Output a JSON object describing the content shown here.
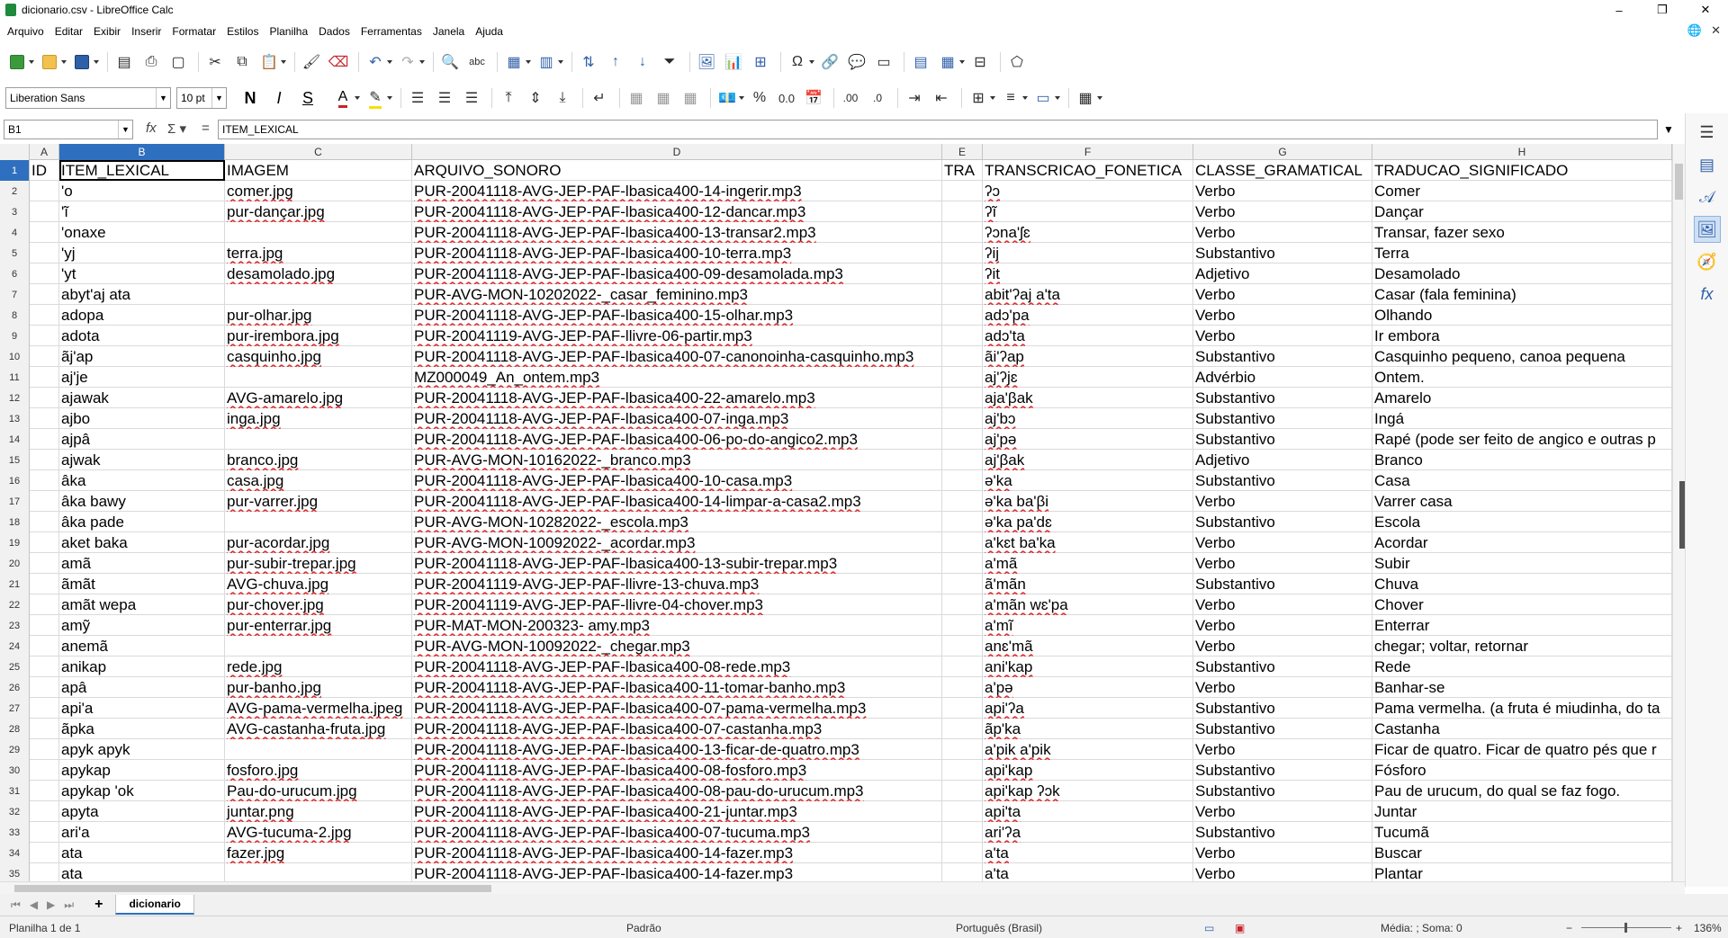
{
  "window": {
    "title": "dicionario.csv - LibreOffice Calc",
    "minimize_label": "–",
    "restore_label": "❐",
    "close_label": "✕"
  },
  "menu": [
    "Arquivo",
    "Editar",
    "Exibir",
    "Inserir",
    "Formatar",
    "Estilos",
    "Planilha",
    "Dados",
    "Ferramentas",
    "Janela",
    "Ajuda"
  ],
  "formatting": {
    "font_name": "Liberation Sans",
    "font_size": "10 pt",
    "bold": "N",
    "italic": "I",
    "shadow": "S"
  },
  "formula_bar": {
    "name_box": "B1",
    "content": "ITEM_LEXICAL"
  },
  "columns": [
    {
      "label": "A",
      "header": "ID"
    },
    {
      "label": "B",
      "header": "ITEM_LEXICAL"
    },
    {
      "label": "C",
      "header": "IMAGEM"
    },
    {
      "label": "D",
      "header": "ARQUIVO_SONORO"
    },
    {
      "label": "E",
      "header": "TRA"
    },
    {
      "label": "F",
      "header": "TRANSCRICAO_FONETICA"
    },
    {
      "label": "G",
      "header": "CLASSE_GRAMATICAL"
    },
    {
      "label": "H",
      "header": "TRADUCAO_SIGNIFICADO"
    }
  ],
  "rows": [
    [
      "",
      "'o",
      "comer.jpg",
      "PUR-20041118-AVG-JEP-PAF-lbasica400-14-ingerir.mp3",
      "",
      "ʔɔ",
      "Verbo",
      "Comer"
    ],
    [
      "",
      "'ĩ",
      "pur-dançar.jpg",
      "PUR-20041118-AVG-JEP-PAF-lbasica400-12-dancar.mp3",
      "",
      "ʔĩ",
      "Verbo",
      "Dançar"
    ],
    [
      "",
      "'onaxe",
      "",
      "PUR-20041118-AVG-JEP-PAF-lbasica400-13-transar2.mp3",
      "",
      "ʔɔna'ʃɛ",
      "Verbo",
      "Transar, fazer sexo"
    ],
    [
      "",
      "'yj",
      "terra.jpg",
      "PUR-20041118-AVG-JEP-PAF-lbasica400-10-terra.mp3",
      "",
      "ʔij",
      "Substantivo",
      "Terra"
    ],
    [
      "",
      "'yt",
      "desamolado.jpg",
      "PUR-20041118-AVG-JEP-PAF-lbasica400-09-desamolada.mp3",
      "",
      "ʔit",
      "Adjetivo",
      "Desamolado"
    ],
    [
      "",
      "abyt'aj ata",
      "",
      "PUR-AVG-MON-10202022-_casar_feminino.mp3",
      "",
      "abit'ʔaj a'ta",
      "Verbo",
      "Casar (fala feminina)"
    ],
    [
      "",
      "adopa",
      "pur-olhar.jpg",
      "PUR-20041118-AVG-JEP-PAF-lbasica400-15-olhar.mp3",
      "",
      "adɔ'pa",
      "Verbo",
      "Olhando"
    ],
    [
      "",
      "adota",
      "pur-irembora.jpg",
      "PUR-20041119-AVG-JEP-PAF-llivre-06-partir.mp3",
      "",
      "adɔ'ta",
      "Verbo",
      "Ir embora"
    ],
    [
      "",
      "ãj'ap",
      "casquinho.jpg",
      "PUR-20041118-AVG-JEP-PAF-lbasica400-07-canonoinha-casquinho.mp3",
      "",
      "ãi'ʔap",
      "Substantivo",
      "Casquinho pequeno, canoa pequena"
    ],
    [
      "",
      "aj'je",
      "",
      "MZ000049_An_ontem.mp3",
      "",
      "aj'ʔjɛ",
      "Advérbio",
      "Ontem."
    ],
    [
      "",
      "ajawak",
      "AVG-amarelo.jpg",
      "PUR-20041118-AVG-JEP-PAF-lbasica400-22-amarelo.mp3",
      "",
      "aja'βak",
      "Substantivo",
      "Amarelo"
    ],
    [
      "",
      "ajbo",
      "inga.jpg",
      "PUR-20041118-AVG-JEP-PAF-lbasica400-07-inga.mp3",
      "",
      "aj'bɔ",
      "Substantivo",
      "Ingá"
    ],
    [
      "",
      "ajpâ",
      "",
      "PUR-20041118-AVG-JEP-PAF-lbasica400-06-po-do-angico2.mp3",
      "",
      "aj'pə",
      "Substantivo",
      "Rapé (pode ser feito de angico e outras p"
    ],
    [
      "",
      "ajwak",
      "branco.jpg",
      "PUR-AVG-MON-10162022-_branco.mp3",
      "",
      "aj'βak",
      "Adjetivo",
      "Branco"
    ],
    [
      "",
      "âka",
      "casa.jpg",
      "PUR-20041118-AVG-JEP-PAF-lbasica400-10-casa.mp3",
      "",
      "ə'ka",
      "Substantivo",
      "Casa"
    ],
    [
      "",
      "âka bawy",
      "pur-varrer.jpg",
      "PUR-20041118-AVG-JEP-PAF-lbasica400-14-limpar-a-casa2.mp3",
      "",
      "ə'ka ba'βi",
      "Verbo",
      "Varrer casa"
    ],
    [
      "",
      "âka pade",
      "",
      "PUR-AVG-MON-10282022-_escola.mp3",
      "",
      "ə'ka pa'dɛ",
      "Substantivo",
      "Escola"
    ],
    [
      "",
      "aket baka",
      "pur-acordar.jpg",
      "PUR-AVG-MON-10092022-_acordar.mp3",
      "",
      "a'kɛt ba'ka",
      "Verbo",
      "Acordar"
    ],
    [
      "",
      "amã",
      "pur-subir-trepar.jpg",
      "PUR-20041118-AVG-JEP-PAF-lbasica400-13-subir-trepar.mp3",
      "",
      "a'mã",
      "Verbo",
      "Subir"
    ],
    [
      "",
      "ãmãt",
      "AVG-chuva.jpg",
      "PUR-20041119-AVG-JEP-PAF-llivre-13-chuva.mp3",
      "",
      "ã'mãn",
      "Substantivo",
      "Chuva"
    ],
    [
      "",
      "amãt wepa",
      "pur-chover.jpg",
      "PUR-20041119-AVG-JEP-PAF-llivre-04-chover.mp3",
      "",
      "a'mãn wɛ'pa",
      "Verbo",
      "Chover"
    ],
    [
      "",
      "amỹ",
      "pur-enterrar.jpg",
      "PUR-MAT-MON-200323- amy.mp3",
      "",
      "a'mĩ",
      "Verbo",
      "Enterrar"
    ],
    [
      "",
      "anemã",
      "",
      "PUR-AVG-MON-10092022-_chegar.mp3",
      "",
      "anɛ'mã",
      "Verbo",
      "chegar; voltar, retornar"
    ],
    [
      "",
      "anikap",
      "rede.jpg",
      "PUR-20041118-AVG-JEP-PAF-lbasica400-08-rede.mp3",
      "",
      "ani'kap",
      "Substantivo",
      "Rede"
    ],
    [
      "",
      "apâ",
      "pur-banho.jpg",
      "PUR-20041118-AVG-JEP-PAF-lbasica400-11-tomar-banho.mp3",
      "",
      "a'pə",
      "Verbo",
      "Banhar-se"
    ],
    [
      "",
      "api'a",
      "AVG-pama-vermelha.jpeg",
      "PUR-20041118-AVG-JEP-PAF-lbasica400-07-pama-vermelha.mp3",
      "",
      "api'ʔa",
      "Substantivo",
      "Pama vermelha. (a fruta é miudinha, do ta"
    ],
    [
      "",
      "ãpka",
      "AVG-castanha-fruta.jpg",
      "PUR-20041118-AVG-JEP-PAF-lbasica400-07-castanha.mp3",
      "",
      "ãp'ka",
      "Substantivo",
      "Castanha"
    ],
    [
      "",
      "apyk apyk",
      "",
      "PUR-20041118-AVG-JEP-PAF-lbasica400-13-ficar-de-quatro.mp3",
      "",
      "a'pik a'pik",
      "Verbo",
      "Ficar de quatro. Ficar de quatro pés que r"
    ],
    [
      "",
      "apykap",
      "fosforo.jpg",
      "PUR-20041118-AVG-JEP-PAF-lbasica400-08-fosforo.mp3",
      "",
      "api'kap",
      "Substantivo",
      "Fósforo"
    ],
    [
      "",
      "apykap 'ok",
      "Pau-do-urucum.jpg",
      "PUR-20041118-AVG-JEP-PAF-lbasica400-08-pau-do-urucum.mp3",
      "",
      "api'kap ʔɔk",
      "Substantivo",
      "Pau de urucum, do qual se faz fogo."
    ],
    [
      "",
      "apyta",
      "juntar.png",
      "PUR-20041118-AVG-JEP-PAF-lbasica400-21-juntar.mp3",
      "",
      "api'ta",
      "Verbo",
      "Juntar"
    ],
    [
      "",
      "ari'a",
      "AVG-tucuma-2.jpg",
      "PUR-20041118-AVG-JEP-PAF-lbasica400-07-tucuma.mp3",
      "",
      "ari'ʔa",
      "Substantivo",
      "Tucumã"
    ],
    [
      "",
      "ata",
      "fazer.jpg",
      "PUR-20041118-AVG-JEP-PAF-lbasica400-14-fazer.mp3",
      "",
      "a'ta",
      "Verbo",
      "Buscar"
    ],
    [
      "",
      "ata",
      "",
      "PUR-20041118-AVG-JEP-PAF-lbasica400-14-fazer.mp3",
      "",
      "a'ta",
      "Verbo",
      "Plantar"
    ]
  ],
  "sheet_tab": "dicionario",
  "status": {
    "sheet": "Planilha 1 de 1",
    "style": "Padrão",
    "language": "Português (Brasil)",
    "sum": "Média: ; Soma: 0",
    "zoom": "136%"
  }
}
